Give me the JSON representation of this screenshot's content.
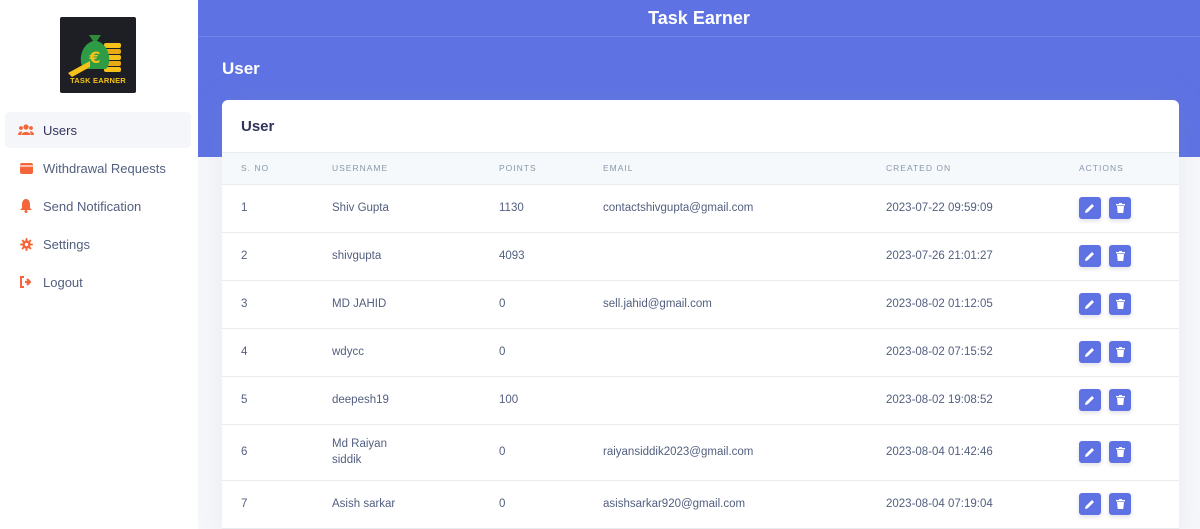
{
  "app": {
    "title": "Task Earner",
    "logo_text": "TASK EARNER"
  },
  "colors": {
    "primary": "#5e72e4",
    "sidebar_icon": "#f5653a",
    "logo_bg": "#1e1f24",
    "logo_gold": "#f6c21a"
  },
  "sidebar": {
    "items": [
      {
        "label": "Users",
        "icon": "users-icon",
        "active": true
      },
      {
        "label": "Withdrawal Requests",
        "icon": "wallet-icon",
        "active": false
      },
      {
        "label": "Send Notification",
        "icon": "bell-icon",
        "active": false
      },
      {
        "label": "Settings",
        "icon": "gear-icon",
        "active": false
      },
      {
        "label": "Logout",
        "icon": "logout-icon",
        "active": false
      }
    ]
  },
  "header": {
    "page_title": "User"
  },
  "card": {
    "title": "User"
  },
  "table": {
    "columns": [
      "S. No",
      "Username",
      "Points",
      "Email",
      "Created On",
      "Actions"
    ],
    "rows": [
      {
        "sno": "1",
        "username": "Shiv Gupta",
        "points": "1130",
        "email": "contactshivgupta@gmail.com",
        "created_on": "2023-07-22 09:59:09"
      },
      {
        "sno": "2",
        "username": "shivgupta",
        "points": "4093",
        "email": "",
        "created_on": "2023-07-26 21:01:27"
      },
      {
        "sno": "3",
        "username": "MD JAHID",
        "points": "0",
        "email": "sell.jahid@gmail.com",
        "created_on": "2023-08-02 01:12:05"
      },
      {
        "sno": "4",
        "username": "wdycc",
        "points": "0",
        "email": "",
        "created_on": "2023-08-02 07:15:52"
      },
      {
        "sno": "5",
        "username": "deepesh19",
        "points": "100",
        "email": "",
        "created_on": "2023-08-02 19:08:52"
      },
      {
        "sno": "6",
        "username_lines": [
          "Md Raiyan",
          "siddik"
        ],
        "points": "0",
        "email": "raiyansiddik2023@gmail.com",
        "created_on": "2023-08-04 01:42:46"
      },
      {
        "sno": "7",
        "username": "Asish sarkar",
        "points": "0",
        "email": "asishsarkar920@gmail.com",
        "created_on": "2023-08-04 07:19:04"
      }
    ]
  }
}
